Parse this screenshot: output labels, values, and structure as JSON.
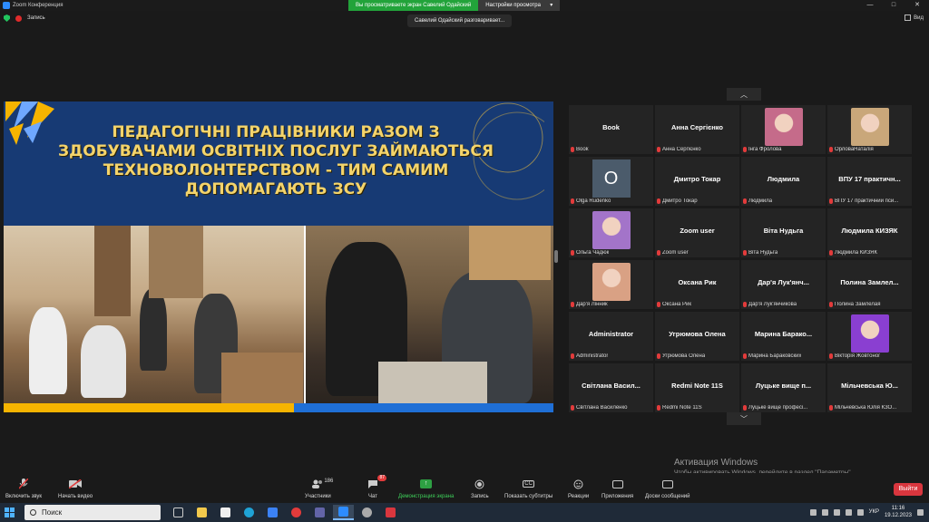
{
  "window": {
    "title": "Zoom Конференция",
    "controls": [
      "—",
      "□",
      "✕"
    ]
  },
  "share_banner": {
    "viewing_text": "Вы просматриваете экран Савелий Одайский",
    "view_options": "Настройки просмотра",
    "chevron": "▾"
  },
  "status": {
    "recording_label": "Запись",
    "speaking_tooltip": "Савелий Одайский разговаривает...",
    "view_label": "Вид"
  },
  "slide": {
    "title": "ПЕДАГОГІЧНІ ПРАЦІВНИКИ РАЗОМ З ЗДОБУВАЧАМИ ОСВІТНІХ ПОСЛУГ ЗАЙМАЮТЬСЯ ТЕХНОВОЛОНТЕРСТВОМ - ТИМ САМИМ ДОПОМАГАЮТЬ ЗСУ",
    "colors": {
      "header": "#173a74",
      "title": "#f4d46b",
      "stripe_yellow": "#f6b400",
      "stripe_blue": "#1f6fd6"
    }
  },
  "gallery": {
    "up_arrow": "︿",
    "down_arrow": "﹀",
    "tiles": [
      {
        "big": "Book",
        "small": "Book"
      },
      {
        "big": "Анна Сергієнко",
        "small": "Анна Сергієнко"
      },
      {
        "big": "",
        "small": "Інга Фролова",
        "avatar_color": "#c56b8a"
      },
      {
        "big": "",
        "small": "ОрловаНаталія",
        "avatar_color": "#c9a77a"
      },
      {
        "big": "",
        "small": "Olga Rudenko",
        "letter": "O"
      },
      {
        "big": "Дмитро Токар",
        "small": "Дмитро Токар"
      },
      {
        "big": "Людмила",
        "small": "Людмила"
      },
      {
        "big": "ВПУ 17 практичн...",
        "small": "ВПУ 17 практичний пси..."
      },
      {
        "big": "",
        "small": "Ольга Чадюк",
        "avatar_color": "#a374c9"
      },
      {
        "big": "Zoom user",
        "small": "Zoom user"
      },
      {
        "big": "Віта Нудьга",
        "small": "Віта Нудьга"
      },
      {
        "big": "Людмила КИЗЯК",
        "small": "Людмила КИЗЯК"
      },
      {
        "big": "",
        "small": "Дар'я Лінник",
        "avatar_color": "#d9a184"
      },
      {
        "big": "Оксана Рик",
        "small": "Оксана Рик"
      },
      {
        "big": "Дар'я Лук'янч...",
        "small": "Дар'я Лук'янчикова"
      },
      {
        "big": "Полина Замлел...",
        "small": "Полина Замлелая"
      },
      {
        "big": "Administrator",
        "small": "Administrator"
      },
      {
        "big": "Угрюмова Олена",
        "small": "Угрюмова Олена"
      },
      {
        "big": "Марина Барако...",
        "small": "Марина Бараковских"
      },
      {
        "big": "",
        "small": "Вікторія Жовтоног",
        "avatar_color": "#8a3fd1"
      },
      {
        "big": "Світлана Васил...",
        "small": "Світлана Василенко"
      },
      {
        "big": "Redmi Note 11S",
        "small": "Redmi Note 11S"
      },
      {
        "big": "Луцьке вище п...",
        "small": "Луцьке вище професі..."
      },
      {
        "big": "Мільчевська Ю...",
        "small": "Мільчевська Юлія КЗО..."
      }
    ]
  },
  "activation": {
    "title": "Активация Windows",
    "subtitle": "Чтобы активировать Windows, перейдите в раздел \"Параметры\"."
  },
  "toolbar": {
    "mute": "Включить звук",
    "video": "Начать видео",
    "participants": "Участники",
    "participants_count": "186",
    "chat": "Чат",
    "chat_badge": "87",
    "share": "Демонстрация экрана",
    "record": "Запись",
    "subtitles": "Показать субтитры",
    "reactions": "Реакции",
    "apps": "Приложения",
    "whiteboard": "Доски сообщений",
    "leave": "Выйти",
    "cc_icon": "CC"
  },
  "taskbar": {
    "search": "Поиск",
    "lang": "УКР",
    "time": "11:16",
    "date": "19.12.2023"
  }
}
